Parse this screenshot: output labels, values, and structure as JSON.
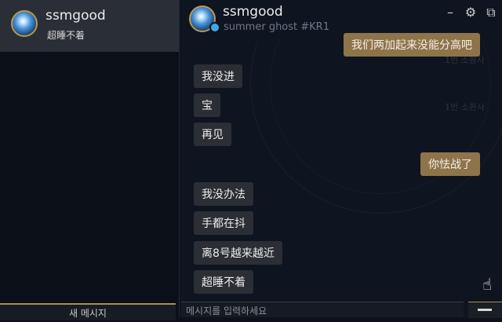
{
  "sidebar": {
    "contact": {
      "name": "ssmgood",
      "status": "超睡不着"
    },
    "new_message_label": "새 메시지"
  },
  "chat": {
    "header": {
      "name": "ssmgood",
      "tag": "summer ghost #KR1"
    },
    "side_ghost": [
      "1번 소환사",
      "1번 소환사"
    ],
    "messages": [
      {
        "dir": "out",
        "text": "我们两加起来没能分高吧"
      },
      {
        "dir": "in",
        "text": "我没进"
      },
      {
        "dir": "in",
        "text": "宝"
      },
      {
        "dir": "in",
        "text": "再见"
      },
      {
        "dir": "out",
        "text": "你怯战了"
      },
      {
        "dir": "in",
        "text": "我没办法"
      },
      {
        "dir": "in",
        "text": "手都在抖"
      },
      {
        "dir": "in",
        "text": "离8号越来越近"
      },
      {
        "dir": "in",
        "text": "超睡不着"
      }
    ],
    "input_placeholder": "메시지를 입력하세요"
  },
  "window_controls": [
    "minimize-icon",
    "gear-icon",
    "popout-icon"
  ],
  "colors": {
    "accent_gold": "#a88e55",
    "bubble_out": "#8e744b",
    "bubble_in": "#2b2e34",
    "online": "#3fa9e8"
  }
}
